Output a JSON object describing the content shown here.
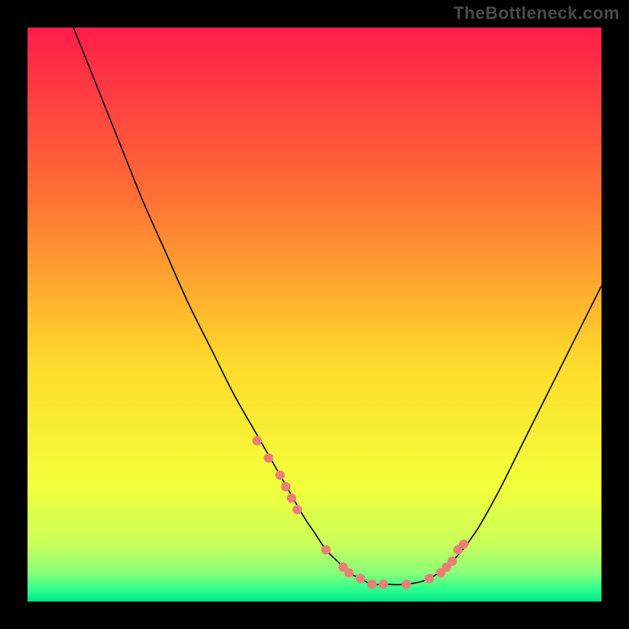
{
  "watermark": "TheBottleneck.com",
  "gradient": {
    "top": "#ff1d4a",
    "q1": "#ff6b35",
    "mid": "#ffd92b",
    "q3": "#f2ff3a",
    "band1": "#c9ff5a",
    "band2": "#8aff7a",
    "band3": "#2aff8f",
    "bottom": "#00e487"
  },
  "chart_data": {
    "type": "line",
    "title": "",
    "xlabel": "",
    "ylabel": "",
    "xlim": [
      0,
      100
    ],
    "ylim": [
      0,
      100
    ],
    "x": [
      8,
      12,
      16,
      20,
      24,
      28,
      32,
      36,
      40,
      44,
      48,
      50,
      52,
      54,
      56,
      58,
      60,
      62,
      66,
      70,
      74,
      78,
      82,
      86,
      90,
      94,
      98,
      100
    ],
    "values": [
      100,
      90,
      80,
      70,
      61,
      52,
      44,
      36,
      29,
      22,
      15,
      12,
      9,
      7,
      5,
      4,
      3,
      3,
      3,
      4,
      7,
      12,
      19,
      27,
      35,
      43,
      51,
      55
    ],
    "markers_x": [
      40,
      42,
      44,
      45,
      46,
      47,
      52,
      55,
      56,
      58,
      60,
      62,
      66,
      70,
      72,
      73,
      74,
      75,
      76
    ],
    "markers_y": [
      28,
      25,
      22,
      20,
      18,
      16,
      9,
      6,
      5,
      4,
      3,
      3,
      3,
      4,
      5,
      6,
      7,
      9,
      10
    ],
    "curve_color": "#000000",
    "marker_color": "#e98075"
  }
}
